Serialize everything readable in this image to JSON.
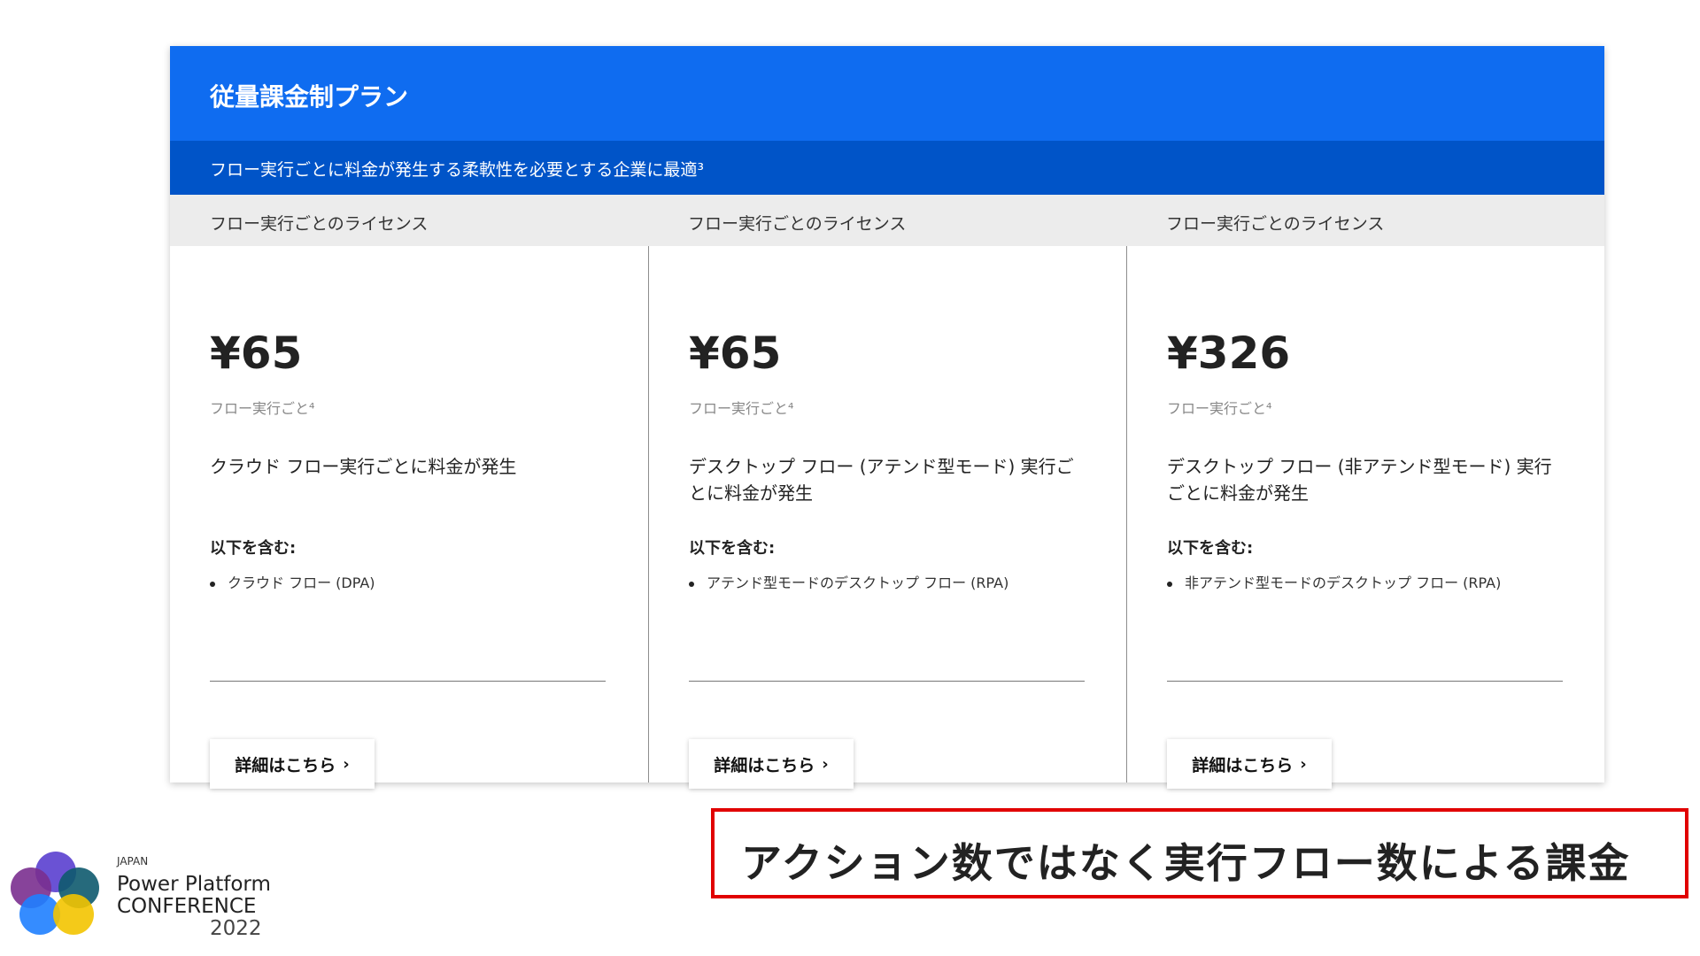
{
  "header": {
    "title": "従量課金制プラン",
    "subtitle": "フロー実行ごとに料金が発生する柔軟性を必要とする企業に最適³"
  },
  "plans": [
    {
      "heading": "フロー実行ごとのライセンス",
      "price": "¥65",
      "unit": "フロー実行ごと⁴",
      "description": "クラウド フロー実行ごとに料金が発生",
      "includes_label": "以下を含む:",
      "includes": [
        "クラウド フロー (DPA)"
      ],
      "button": "詳細はこちら"
    },
    {
      "heading": "フロー実行ごとのライセンス",
      "price": "¥65",
      "unit": "フロー実行ごと⁴",
      "description": "デスクトップ フロー (アテンド型モード) 実行ごとに料金が発生",
      "includes_label": "以下を含む:",
      "includes": [
        "アテンド型モードのデスクトップ フロー (RPA)"
      ],
      "button": "詳細はこちら"
    },
    {
      "heading": "フロー実行ごとのライセンス",
      "price": "¥326",
      "unit": "フロー実行ごと⁴",
      "description": "デスクトップ フロー (非アテンド型モード) 実行ごとに料金が発生",
      "includes_label": "以下を含む:",
      "includes": [
        "非アテンド型モードのデスクトップ フロー (RPA)"
      ],
      "button": "詳細はこちら"
    }
  ],
  "callout": "アクション数ではなく実行フロー数による課金",
  "logo": {
    "small": "JAPAN",
    "line1": "Power Platform",
    "line2": "CONFERENCE",
    "line3": "2022",
    "icon": "overlapping-circles-logo-icon"
  },
  "colors": {
    "header_blue": "#0f6cf0",
    "subheader_blue": "#0054c8",
    "callout_border": "#e10000"
  }
}
